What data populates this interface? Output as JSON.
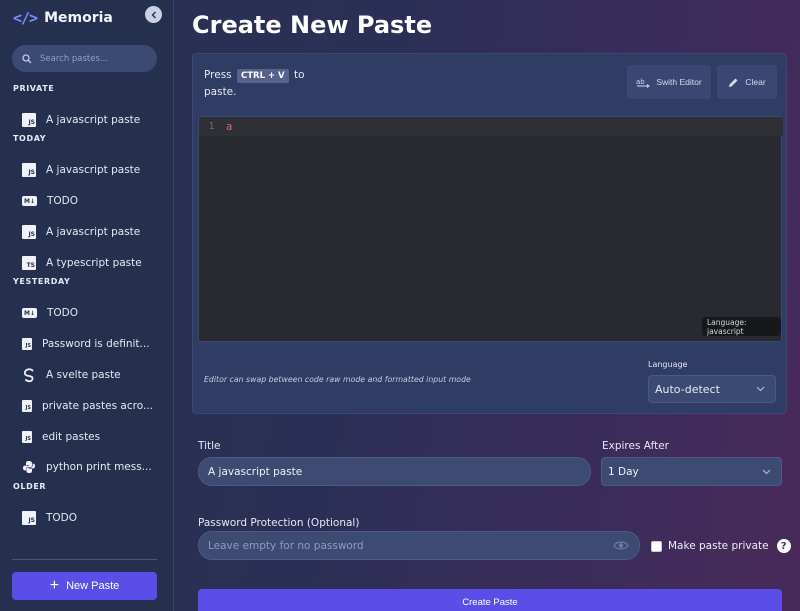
{
  "sidebar": {
    "brand": {
      "logo": "</>",
      "name": "Memoria"
    },
    "collapse_icon": "chevron-left-icon",
    "search": {
      "placeholder": "Search pastes..."
    },
    "sections": {
      "private": "PRIVATE",
      "today": "TODAY",
      "yesterday": "YESTERDAY",
      "older": "OLDER"
    },
    "items": [
      {
        "label": "A javascript paste",
        "icon": "JS",
        "section": "private"
      },
      {
        "label": "A javascript paste",
        "icon": "JS",
        "section": "today"
      },
      {
        "label": "TODO",
        "icon": "M↓",
        "section": "today"
      },
      {
        "label": "A javascript paste",
        "icon": "JS",
        "section": "today"
      },
      {
        "label": "A typescript paste",
        "icon": "TS",
        "section": "today"
      },
      {
        "label": "TODO",
        "icon": "M↓",
        "section": "yesterday"
      },
      {
        "label": "Password is definit...",
        "icon": "JS",
        "section": "yesterday"
      },
      {
        "label": "A svelte paste",
        "icon": "svelte-icon",
        "section": "yesterday"
      },
      {
        "label": "private pastes acro...",
        "icon": "JS",
        "section": "yesterday"
      },
      {
        "label": "edit pastes",
        "icon": "JS",
        "section": "yesterday"
      },
      {
        "label": "python print mess...",
        "icon": "python-icon",
        "section": "yesterday"
      },
      {
        "label": "TODO",
        "icon": "JS",
        "section": "older"
      }
    ],
    "new_paste_label": "New Paste"
  },
  "main": {
    "title": "Create New Paste",
    "editor": {
      "hint_prefix": "Press",
      "hint_key": "CTRL + V",
      "hint_suffix": "to paste.",
      "switch_editor_label": "Swith Editor",
      "clear_label": "Clear",
      "line_number": "1",
      "code": "a",
      "language_tag": "Language: javascript",
      "note": "Editor can swap between code raw mode and formatted input mode",
      "language_label": "Language",
      "language_value": "Auto-detect"
    },
    "form": {
      "title_label": "Title",
      "title_value": "A javascript paste",
      "expires_label": "Expires After",
      "expires_value": "1 Day",
      "password_label": "Password Protection (Optional)",
      "password_placeholder": "Leave empty for no password",
      "private_label": "Make paste private",
      "help_glyph": "?",
      "submit_label": "Create Paste"
    }
  },
  "colors": {
    "accent": "#5b4ee8",
    "sidebar_bg": "#25304f",
    "card_bg": "#2f3c63",
    "code_bg": "#282a2f",
    "code_text": "#e0636f"
  }
}
